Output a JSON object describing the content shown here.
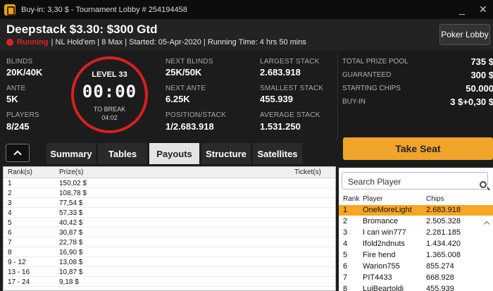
{
  "window": {
    "title": "Buy-in: 3,30 $ - Tournament Lobby # 254194458",
    "minimize": "_",
    "close": "✕"
  },
  "header": {
    "event_title": "Deepstack $3.30: $300 Gtd",
    "status": "Running",
    "details": "| NL Hold'em | 8 Max | Started: 05-Apr-2020 | Running Time: 4 hrs  50 mins",
    "lobby_button": "Poker Lobby"
  },
  "info": {
    "blinds_label": "BLINDS",
    "blinds": "20K/40K",
    "ante_label": "ANTE",
    "ante": "5K",
    "players_label": "PLAYERS",
    "players": "8/245",
    "next_blinds_label": "NEXT BLINDS",
    "next_blinds": "25K/50K",
    "next_ante_label": "NEXT ANTE",
    "next_ante": "6.25K",
    "position_label": "POSITION/STACK",
    "position": "1/2.683.918",
    "largest_label": "LARGEST STACK",
    "largest": "2.683.918",
    "smallest_label": "SMALLEST STACK",
    "smallest": "455.939",
    "average_label": "AVERAGE STACK",
    "average": "1.531.250"
  },
  "clock": {
    "level": "LEVEL 33",
    "time": "00:00",
    "break_label": "TO BREAK",
    "break_time": "04:02"
  },
  "prize": {
    "total_label": "TOTAL PRIZE POOL",
    "total": "735 $",
    "guaranteed_label": "GUARANTEED",
    "guaranteed": "300 $",
    "starting_label": "STARTING CHIPS",
    "starting": "50.000",
    "buyin_label": "BUY-IN",
    "buyin": "3 $+0,30 $"
  },
  "tabs": [
    "Summary",
    "Tables",
    "Payouts",
    "Structure",
    "Satellites"
  ],
  "take_seat": "Take Seat",
  "payouts": {
    "headers": {
      "rank": "Rank(s)",
      "prize": "Prize(s)",
      "ticket": "Ticket(s)"
    },
    "rows": [
      {
        "rank": "1",
        "prize": "150,02 $"
      },
      {
        "rank": "2",
        "prize": "108,78 $"
      },
      {
        "rank": "3",
        "prize": "77,54 $"
      },
      {
        "rank": "4",
        "prize": "57,33 $"
      },
      {
        "rank": "5",
        "prize": "40,42 $"
      },
      {
        "rank": "6",
        "prize": "30,87 $"
      },
      {
        "rank": "7",
        "prize": "22,78 $"
      },
      {
        "rank": "8",
        "prize": "16,90 $"
      },
      {
        "rank": "9 - 12",
        "prize": "13,08 $"
      },
      {
        "rank": "13 - 16",
        "prize": "10,87 $"
      },
      {
        "rank": "17 - 24",
        "prize": "9,18 $"
      }
    ]
  },
  "players_panel": {
    "search_placeholder": "Search Player",
    "headers": {
      "rank": "Rank",
      "player": "Player",
      "chips": "Chips"
    },
    "rows": [
      {
        "rank": "1",
        "player": "OneMoreLight",
        "chips": "2.683.918"
      },
      {
        "rank": "2",
        "player": "Bromance",
        "chips": "2.505.328"
      },
      {
        "rank": "3",
        "player": "I can win777",
        "chips": "2.281.185"
      },
      {
        "rank": "4",
        "player": "Ifold2ndnuts",
        "chips": "1.434.420"
      },
      {
        "rank": "5",
        "player": "Fire hend",
        "chips": "1.365.008"
      },
      {
        "rank": "6",
        "player": "Warion755",
        "chips": "855.274"
      },
      {
        "rank": "7",
        "player": "PIT4433",
        "chips": "668.928"
      },
      {
        "rank": "8",
        "player": "LuiBeartoldi",
        "chips": "455.939"
      }
    ]
  },
  "colors": {
    "accent": "#f0a42a",
    "running": "#e02020",
    "clock_ring": "#d8201f"
  }
}
